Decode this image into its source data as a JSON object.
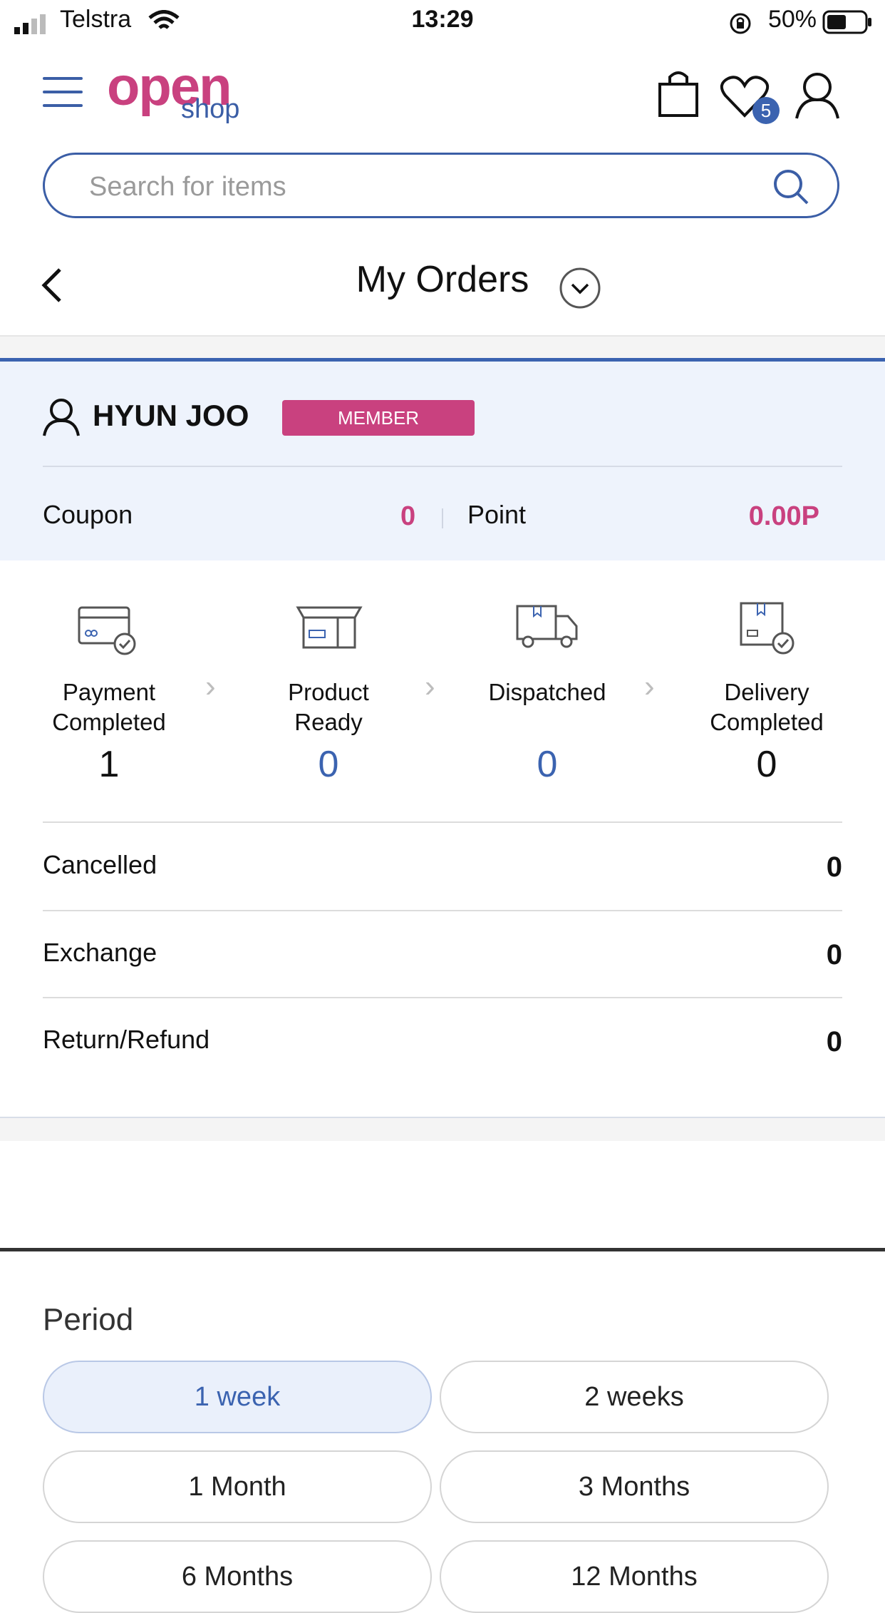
{
  "status_bar": {
    "carrier": "Telstra",
    "time": "13:29",
    "battery": "50%"
  },
  "header": {
    "logo_main": "open",
    "logo_sub": "shop",
    "wishlist_count": "5"
  },
  "search": {
    "placeholder": "Search for items"
  },
  "page": {
    "title": "My Orders"
  },
  "member": {
    "name": "HYUN JOO",
    "badge": "MEMBER",
    "coupon_label": "Coupon",
    "coupon_value": "0",
    "point_label": "Point",
    "point_value": "0.00P"
  },
  "steps": [
    {
      "label_line1": "Payment",
      "label_line2": "Completed",
      "count": "1"
    },
    {
      "label_line1": "Product",
      "label_line2": "Ready",
      "count": "0"
    },
    {
      "label_line1": "Dispatched",
      "label_line2": "",
      "count": "0"
    },
    {
      "label_line1": "Delivery",
      "label_line2": "Completed",
      "count": "0"
    }
  ],
  "rows": [
    {
      "label": "Cancelled",
      "value": "0"
    },
    {
      "label": "Exchange",
      "value": "0"
    },
    {
      "label": "Return/Refund",
      "value": "0"
    }
  ],
  "period": {
    "title": "Period",
    "options": [
      "1 week",
      "2 weeks",
      "1 Month",
      "3 Months",
      "6 Months",
      "12 Months"
    ],
    "selected": "1 week"
  },
  "colors": {
    "accent_blue": "#3b63b0",
    "accent_pink": "#c9417f"
  }
}
